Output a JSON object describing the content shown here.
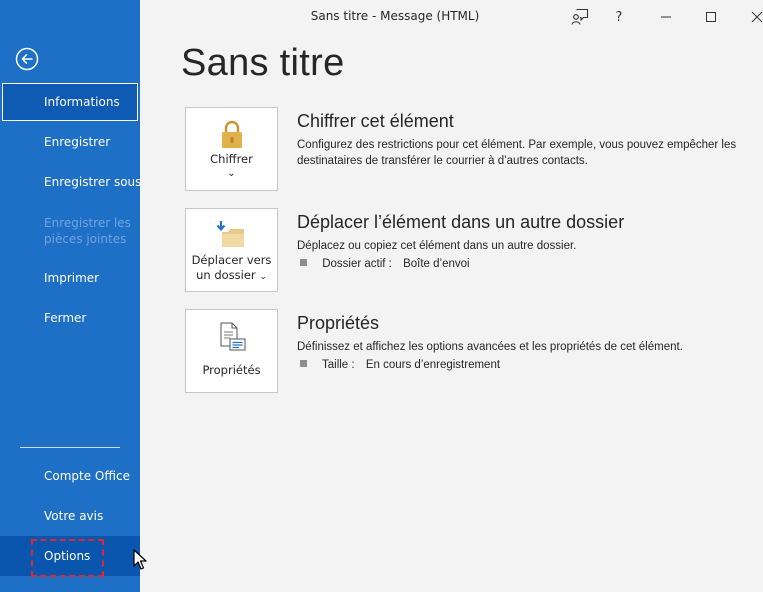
{
  "window": {
    "title": "Sans titre  -  Message (HTML)"
  },
  "sidebar": {
    "back_icon": "back-arrow-icon",
    "items": [
      {
        "label": "Informations",
        "state": "selected"
      },
      {
        "label": "Enregistrer"
      },
      {
        "label": "Enregistrer sous"
      },
      {
        "label_line1": "Enregistrer les",
        "label_line2": "pièces jointes",
        "state": "disabled"
      },
      {
        "label": "Imprimer"
      },
      {
        "label": "Fermer"
      }
    ],
    "bottom_items": [
      {
        "label": "Compte Office"
      },
      {
        "label": "Votre avis"
      },
      {
        "label": "Options",
        "state": "hovered"
      }
    ]
  },
  "page": {
    "title": "Sans titre"
  },
  "sections": {
    "encrypt": {
      "button_label": "Chiffrer",
      "title": "Chiffrer cet élément",
      "description": "Configurez des restrictions pour cet élément. Par exemple, vous pouvez empêcher les destinataires de transférer le courrier à d’autres contacts."
    },
    "move": {
      "button_label_line1": "Déplacer vers",
      "button_label_line2": "un dossier",
      "title": "Déplacer l’élément dans un autre dossier",
      "description": "Déplacez ou copiez cet élément dans un autre dossier.",
      "prop_label": "Dossier actif :",
      "prop_value": "Boîte d’envoi"
    },
    "properties": {
      "button_label": "Propriétés",
      "title": "Propriétés",
      "description": "Définissez et affichez les options avancées et les propriétés de cet élément.",
      "prop_label": "Taille :",
      "prop_value": "En cours d’enregistrement"
    }
  },
  "colors": {
    "sidebar_bg": "#1e6fc6",
    "accent_gold": "#e0b24b",
    "highlight_red": "#e0282e"
  }
}
